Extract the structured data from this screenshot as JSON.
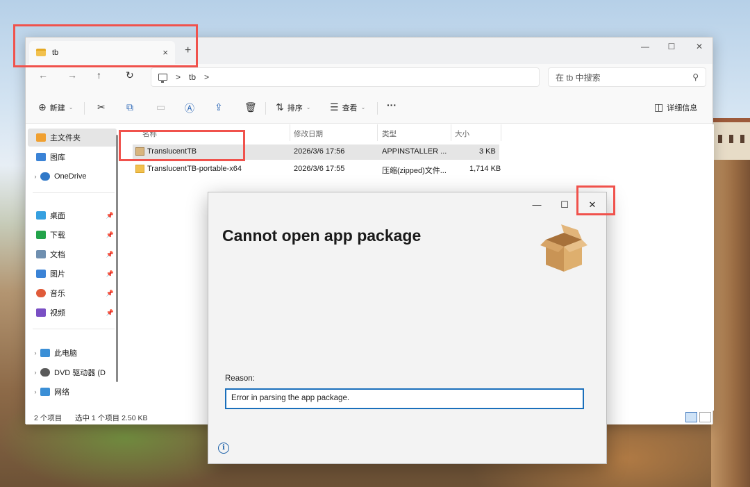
{
  "explorer": {
    "tab_title": "tb",
    "tab_close": "×",
    "new_tab": "+",
    "window_controls": [
      "—",
      "☐",
      "✕"
    ],
    "nav": {
      "back": "←",
      "forward": "→",
      "up": "↑",
      "refresh": "↻"
    },
    "address": {
      "sep1": ">",
      "folder": "tb",
      "sep2": ">"
    },
    "search_placeholder": "在 tb 中搜索",
    "search_icon": "⚲",
    "toolbar": {
      "new_label": "新建",
      "sort_label": "排序",
      "view_label": "查看",
      "more": "···",
      "details_label": "详细信息"
    },
    "sidebar": {
      "items": [
        {
          "label": "主文件夹",
          "icon": "home-icon",
          "color": "#f0a030"
        },
        {
          "label": "图库",
          "icon": "gallery-icon",
          "color": "#3b83d6"
        },
        {
          "label": "OneDrive",
          "icon": "cloud-icon",
          "color": "#2f78c8"
        },
        {
          "label": "桌面",
          "icon": "desktop-icon",
          "color": "#36a0e0"
        },
        {
          "label": "下载",
          "icon": "download-icon",
          "color": "#23a34a"
        },
        {
          "label": "文档",
          "icon": "document-icon",
          "color": "#6f8fb0"
        },
        {
          "label": "图片",
          "icon": "pictures-icon",
          "color": "#3b83d6"
        },
        {
          "label": "音乐",
          "icon": "music-icon",
          "color": "#e05b3a"
        },
        {
          "label": "视频",
          "icon": "video-icon",
          "color": "#7a4fc4"
        },
        {
          "label": "此电脑",
          "icon": "pc-icon",
          "color": "#3b8fd6"
        },
        {
          "label": "DVD 驱动器 (D",
          "icon": "dvd-icon",
          "color": "#5a5a5a"
        },
        {
          "label": "网络",
          "icon": "network-icon",
          "color": "#3b8fd6"
        }
      ]
    },
    "columns": {
      "name": "名称",
      "modified": "修改日期",
      "type": "类型",
      "size": "大小"
    },
    "files": [
      {
        "name": "TranslucentTB",
        "modified": "2026/3/6 17:56",
        "type": "APPINSTALLER ...",
        "size": "3 KB"
      },
      {
        "name": "TranslucentTB-portable-x64",
        "modified": "2026/3/6 17:55",
        "type": "压缩(zipped)文件...",
        "size": "1,714 KB"
      }
    ],
    "status": {
      "count": "2 个项目",
      "selected": "选中 1 个项目  2.50 KB"
    }
  },
  "dialog": {
    "controls": [
      "—",
      "☐",
      "✕"
    ],
    "title": "Cannot open app package",
    "reason_label": "Reason:",
    "reason_text": "Error in parsing the app package.",
    "info": "i"
  },
  "colors": {
    "annotation": "#f0524c",
    "accent": "#1a6fbb"
  }
}
